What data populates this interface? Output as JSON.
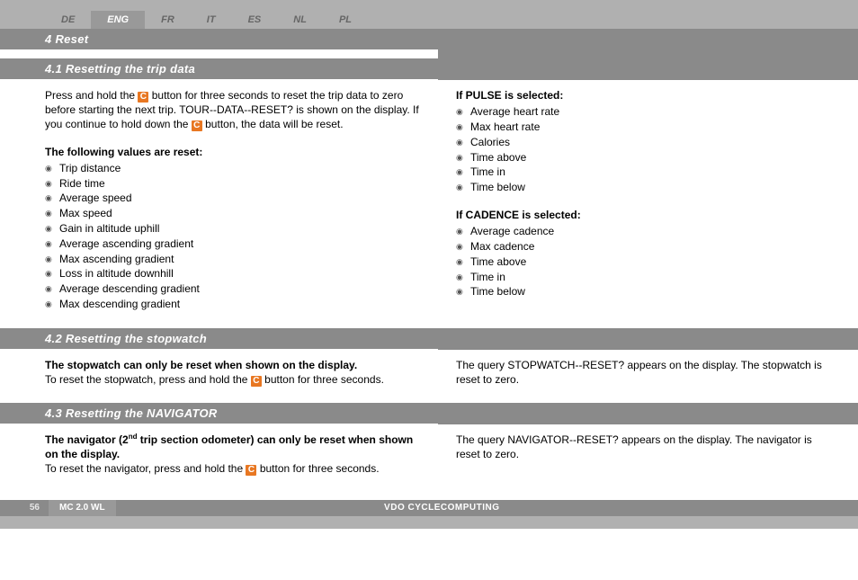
{
  "lang": {
    "tabs": [
      "DE",
      "ENG",
      "FR",
      "IT",
      "ES",
      "NL",
      "PL"
    ],
    "activeIndex": 1
  },
  "s0": {
    "title": "4 Reset"
  },
  "s1": {
    "title": "4.1 Resetting the trip data",
    "p1a": "Press and hold the ",
    "p1b": " button for three seconds to reset the trip data to zero before starting the next trip. TOUR--DATA--RESET? is shown on the display. If you continue to hold down the ",
    "p1c": " button, the data will be reset.",
    "cbtn": "C",
    "listTitle": "The following values are reset:",
    "items": [
      "Trip distance",
      "Ride time",
      "Average speed",
      "Max speed",
      "Gain in altitude uphill",
      "Average ascending gradient",
      "Max ascending gradient",
      "Loss in altitude downhill",
      "Average descending gradient",
      "Max descending gradient"
    ],
    "pulseTitle": "If PULSE is selected:",
    "pulseItems": [
      "Average heart rate",
      "Max heart rate",
      "Calories",
      "Time above",
      "Time in",
      "Time below"
    ],
    "cadTitle": "If CADENCE is selected:",
    "cadItems": [
      "Average cadence",
      "Max cadence",
      "Time above",
      "Time in",
      "Time below"
    ]
  },
  "s2": {
    "title": "4.2 Resetting the stopwatch",
    "leftBold": "The stopwatch can only be reset when shown on the display.",
    "left2a": "To reset the stopwatch, press and hold the ",
    "left2b": " button for three seconds.",
    "right": "The query STOPWATCH--RESET? appears on the display. The stopwatch is reset to zero."
  },
  "s3": {
    "title": "4.3 Resetting the NAVIGATOR",
    "leftBold1": "The navigator (2",
    "leftBoldSup": "nd",
    "leftBold2": " trip section odometer) can only be reset when shown on the display.",
    "left2a": "To reset the navigator, press and hold the ",
    "left2b": " button for three seconds.",
    "right": "The query NAVIGATOR--RESET? appears on the display. The navigator is reset to zero."
  },
  "footer": {
    "page": "56",
    "model": "MC 2.0 WL",
    "brand": "VDO CYCLECOMPUTING"
  }
}
